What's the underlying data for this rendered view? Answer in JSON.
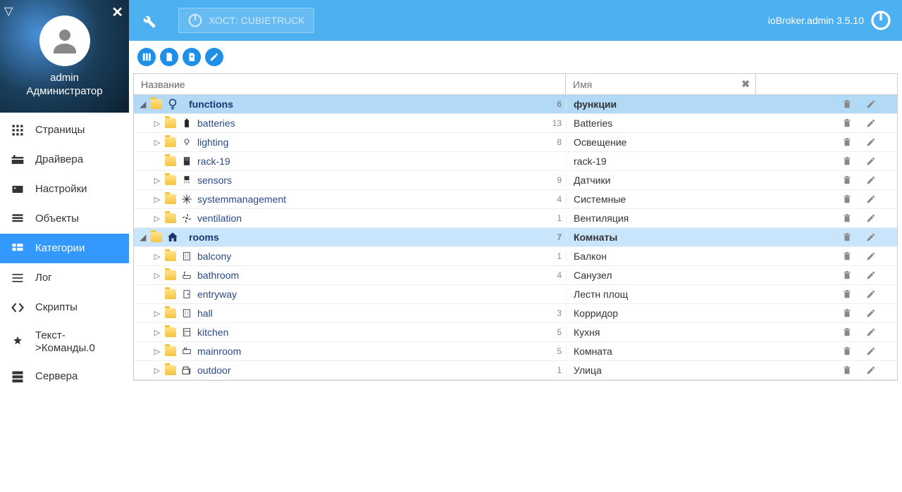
{
  "user": {
    "name": "admin",
    "role": "Администратор"
  },
  "nav": [
    {
      "id": "pages",
      "label": "Страницы"
    },
    {
      "id": "drivers",
      "label": "Драйвера"
    },
    {
      "id": "settings",
      "label": "Настройки"
    },
    {
      "id": "objects",
      "label": "Объекты"
    },
    {
      "id": "categories",
      "label": "Категории",
      "active": true
    },
    {
      "id": "log",
      "label": "Лог"
    },
    {
      "id": "scripts",
      "label": "Скрипты"
    },
    {
      "id": "text2cmd",
      "label": "Текст->Команды.0"
    },
    {
      "id": "servers",
      "label": "Сервера"
    }
  ],
  "header": {
    "host": "ХОСТ: CUBIETRUCK",
    "brand": "ioBroker.admin 3.5.10"
  },
  "columns": {
    "name": "Название",
    "id_placeholder": "Имя"
  },
  "groups": [
    {
      "key": "functions",
      "name": "functions",
      "display": "функции",
      "count": 6,
      "expanded": true,
      "selected": true,
      "icon": "bulb",
      "rows": [
        {
          "key": "batteries",
          "name": "batteries",
          "display": "Batteries",
          "count": 13,
          "icon": "battery",
          "expandable": true
        },
        {
          "key": "lighting",
          "name": "lighting",
          "display": "Освещение",
          "count": 8,
          "icon": "light",
          "expandable": true
        },
        {
          "key": "rack19",
          "name": "rack-19",
          "display": "rack-19",
          "count": "",
          "icon": "rack",
          "expandable": false
        },
        {
          "key": "sensors",
          "name": "sensors",
          "display": "Датчики",
          "count": 9,
          "icon": "sensor",
          "expandable": true
        },
        {
          "key": "sysmgmt",
          "name": "systemmanagement",
          "display": "Системные",
          "count": 4,
          "icon": "snow",
          "expandable": true
        },
        {
          "key": "ventilation",
          "name": "ventilation",
          "display": "Вентиляция",
          "count": 1,
          "icon": "fan",
          "expandable": true
        }
      ]
    },
    {
      "key": "rooms",
      "name": "rooms",
      "display": "Комнаты",
      "count": 7,
      "expanded": true,
      "selected": false,
      "icon": "home",
      "rows": [
        {
          "key": "balcony",
          "name": "balcony",
          "display": "Балкон",
          "count": 1,
          "icon": "building",
          "expandable": true
        },
        {
          "key": "bathroom",
          "name": "bathroom",
          "display": "Санузел",
          "count": 4,
          "icon": "bath",
          "expandable": true
        },
        {
          "key": "entryway",
          "name": "entryway",
          "display": "Лестн площ",
          "count": "",
          "icon": "door",
          "expandable": false
        },
        {
          "key": "hall",
          "name": "hall",
          "display": "Корридор",
          "count": 3,
          "icon": "building",
          "expandable": true
        },
        {
          "key": "kitchen",
          "name": "kitchen",
          "display": "Кухня",
          "count": 5,
          "icon": "kitchen",
          "expandable": true
        },
        {
          "key": "mainroom",
          "name": "mainroom",
          "display": "Комната",
          "count": 5,
          "icon": "room",
          "expandable": true
        },
        {
          "key": "outdoor",
          "name": "outdoor",
          "display": "Улица",
          "count": 1,
          "icon": "outdoor",
          "expandable": true
        }
      ]
    }
  ]
}
